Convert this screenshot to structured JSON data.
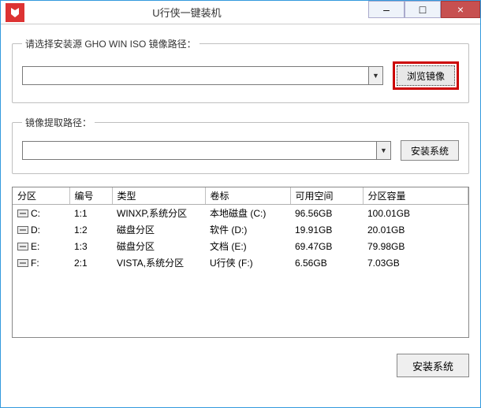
{
  "window": {
    "title": "U行侠一键装机",
    "minimize": "–",
    "maximize": "□",
    "close": "×"
  },
  "source": {
    "legend": "请选择安装源 GHO WIN ISO 镜像路径：",
    "value": "",
    "browse": "浏览镜像"
  },
  "extract": {
    "legend": "镜像提取路径：",
    "value": "",
    "install": "安装系统"
  },
  "table": {
    "headers": {
      "partition": "分区",
      "number": "编号",
      "type": "类型",
      "label": "卷标",
      "free": "可用空间",
      "total": "分区容量"
    },
    "rows": [
      {
        "partition": "C:",
        "number": "1:1",
        "type": "WINXP,系统分区",
        "label": "本地磁盘 (C:)",
        "free": "96.56GB",
        "total": "100.01GB"
      },
      {
        "partition": "D:",
        "number": "1:2",
        "type": "磁盘分区",
        "label": "软件 (D:)",
        "free": "19.91GB",
        "total": "20.01GB"
      },
      {
        "partition": "E:",
        "number": "1:3",
        "type": "磁盘分区",
        "label": "文档 (E:)",
        "free": "69.47GB",
        "total": "79.98GB"
      },
      {
        "partition": "F:",
        "number": "2:1",
        "type": "VISTA,系统分区",
        "label": "U行侠 (F:)",
        "free": "6.56GB",
        "total": "7.03GB"
      }
    ]
  },
  "footer": {
    "install": "安装系统"
  }
}
